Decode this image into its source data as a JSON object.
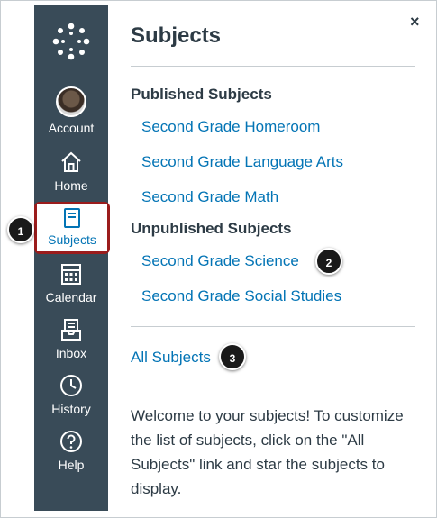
{
  "nav": {
    "items": [
      {
        "label": "Account"
      },
      {
        "label": "Home"
      },
      {
        "label": "Subjects"
      },
      {
        "label": "Calendar"
      },
      {
        "label": "Inbox"
      },
      {
        "label": "History"
      },
      {
        "label": "Help"
      }
    ]
  },
  "tray": {
    "title": "Subjects",
    "close_label": "×",
    "published_heading": "Published Subjects",
    "published": [
      "Second Grade Homeroom",
      "Second Grade Language Arts",
      "Second Grade Math"
    ],
    "unpublished_heading": "Unpublished Subjects",
    "unpublished": [
      "Second Grade Science",
      "Second Grade Social Studies"
    ],
    "all_subjects_link": "All Subjects",
    "welcome_text": "Welcome to your subjects! To customize the list of subjects, click on the \"All Subjects\" link and star the subjects to display."
  },
  "callouts": [
    "1",
    "2",
    "3"
  ],
  "colors": {
    "nav_bg": "#394b58",
    "link": "#0374b5",
    "highlight": "#9b1c1c",
    "text": "#2d3b45"
  }
}
